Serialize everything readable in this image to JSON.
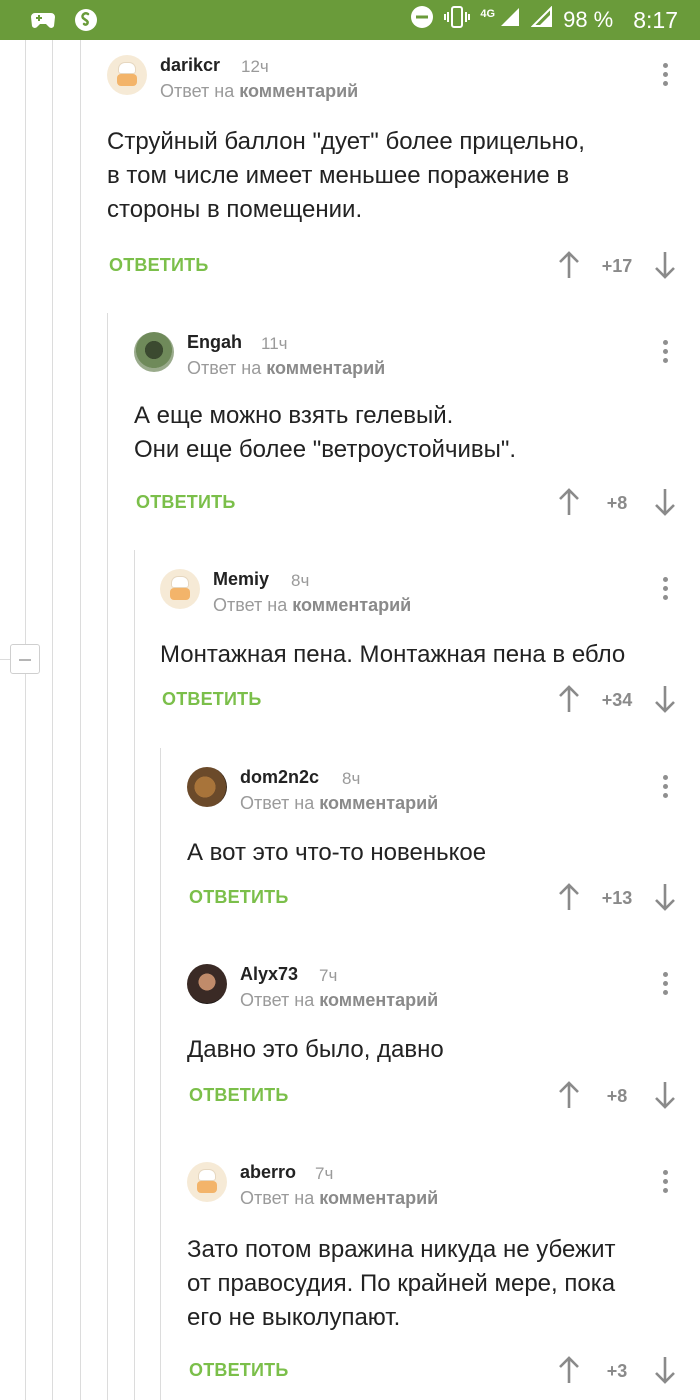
{
  "status_bar": {
    "network": "4G",
    "battery": "98 %",
    "time": "8:17"
  },
  "comments": [
    {
      "author": "darikcr",
      "time": "12ч",
      "reply_prefix": "Ответ на",
      "reply_link": "комментарий",
      "lines": [
        "Струйный баллон \"дует\" более прицельно,",
        "в том числе имеет меньшее поражение в",
        "стороны в помещении."
      ],
      "reply_label": "ОТВЕТИТЬ",
      "rating": "+17"
    },
    {
      "author": "Engah",
      "time": "11ч",
      "reply_prefix": "Ответ на",
      "reply_link": "комментарий",
      "lines": [
        "А еще можно взять гелевый.",
        "Они еще более \"ветроустойчивы\"."
      ],
      "reply_label": "ОТВЕТИТЬ",
      "rating": "+8"
    },
    {
      "author": "Memiy",
      "time": "8ч",
      "reply_prefix": "Ответ на",
      "reply_link": "комментарий",
      "lines": [
        "Монтажная пена. Монтажная пена в ебло"
      ],
      "reply_label": "ОТВЕТИТЬ",
      "rating": "+34"
    },
    {
      "author": "dom2n2c",
      "time": "8ч",
      "reply_prefix": "Ответ на",
      "reply_link": "комментарий",
      "lines": [
        "А вот это что-то новенькое"
      ],
      "reply_label": "ОТВЕТИТЬ",
      "rating": "+13"
    },
    {
      "author": "Alyx73",
      "time": "7ч",
      "reply_prefix": "Ответ на",
      "reply_link": "комментарий",
      "lines": [
        "Давно это было, давно"
      ],
      "reply_label": "ОТВЕТИТЬ",
      "rating": "+8"
    },
    {
      "author": "aberro",
      "time": "7ч",
      "reply_prefix": "Ответ на",
      "reply_link": "комментарий",
      "lines": [
        "Зато потом вражина никуда не убежит",
        "от правосудия. По крайней мере, пока",
        "его не выколупают."
      ],
      "reply_label": "ОТВЕТИТЬ",
      "rating": "+3"
    }
  ]
}
